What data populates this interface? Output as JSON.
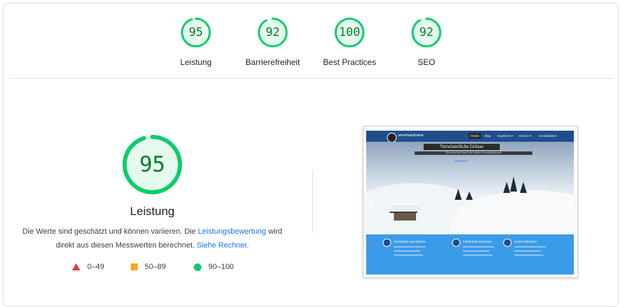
{
  "categories": [
    {
      "label": "Leistung",
      "score": "95",
      "fraction": 0.95
    },
    {
      "label": "Barrierefreiheit",
      "score": "92",
      "fraction": 0.92
    },
    {
      "label": "Best Practices",
      "score": "100",
      "fraction": 1.0
    },
    {
      "label": "SEO",
      "score": "92",
      "fraction": 0.92
    }
  ],
  "main": {
    "score": "95",
    "fraction": 0.95,
    "title": "Leistung",
    "desc_part1": "Die Werte sind geschätzt und können variieren. Die ",
    "link1": "Leistungsbewertung",
    "desc_part2": " wird direkt aus diesen Messwerten berechnet. ",
    "link2": "Siehe Rechner",
    "desc_part3": "."
  },
  "legend": [
    {
      "range": "0–49",
      "shape": "triangle",
      "color": "#e53935"
    },
    {
      "range": "50–89",
      "shape": "square",
      "color": "#f5a623"
    },
    {
      "range": "90–100",
      "shape": "circle",
      "color": "#0cce6b"
    }
  ],
  "screenshot": {
    "logo_text": "ameshapstrasse",
    "nav": [
      "Home",
      "Blog",
      "Angebote ▾",
      "Service ▾",
      "Kontaktdaten"
    ],
    "hero_title": "Vorwinterliche Grüsse",
    "hero_sub": "Wir wünschen Ihnen eine schöne Vorweihnachtszeit",
    "hero_link": "Weiterlesen",
    "features": [
      "Fachkräfte und Wissen",
      "Fehlerfreie Prozesse",
      "Hoher Standard"
    ]
  },
  "colors": {
    "good": "#0cce6b",
    "good_text": "#0a7d2c",
    "good_bg": "#e6f9ee",
    "link": "#1a73e8"
  }
}
